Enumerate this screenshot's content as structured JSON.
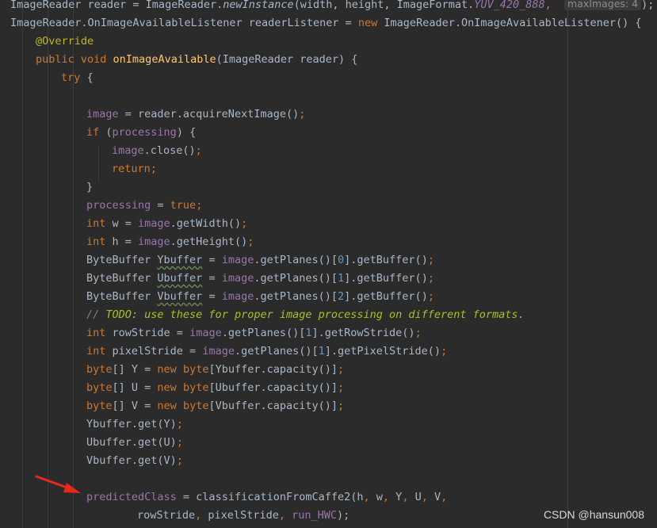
{
  "code": {
    "l0": [
      "ImageReader reader = ImageReader.",
      "newInstance",
      "(width, height, ImageFormat.",
      "YUV_420_888",
      ",",
      "maxImages:",
      "4",
      ");"
    ],
    "l1": [
      "ImageReader.OnImageAvailableListener readerListener = ",
      "new",
      " ImageReader.OnImageAvailableListener() {"
    ],
    "l2": [
      "@Override"
    ],
    "l3": [
      "public void",
      " ",
      "onImageAvailable",
      "(ImageReader reader) {"
    ],
    "l4": [
      "try",
      " {"
    ],
    "l6": [
      "image",
      " = reader.acquireNextImage()",
      ";"
    ],
    "l7": [
      "if",
      " (",
      "processing",
      ") {"
    ],
    "l8": [
      "image",
      ".close()",
      ";"
    ],
    "l9": [
      "return;"
    ],
    "l10": [
      "}"
    ],
    "l11": [
      "processing",
      " = ",
      "true",
      ";"
    ],
    "l12": [
      "int",
      " w = ",
      "image",
      ".getWidth()",
      ";"
    ],
    "l13": [
      "int",
      " h = ",
      "image",
      ".getHeight()",
      ";"
    ],
    "l14": [
      "ByteBuffer ",
      "Ybuffer",
      " = ",
      "image",
      ".getPlanes()[",
      "0",
      "].getBuffer()",
      ";"
    ],
    "l15": [
      "ByteBuffer ",
      "Ubuffer",
      " = ",
      "image",
      ".getPlanes()[",
      "1",
      "].getBuffer()",
      ";"
    ],
    "l16": [
      "ByteBuffer ",
      "Vbuffer",
      " = ",
      "image",
      ".getPlanes()[",
      "2",
      "].getBuffer()",
      ";"
    ],
    "l17": [
      "// ",
      "TODO: use these for proper image processing on different formats."
    ],
    "l18": [
      "int",
      " rowStride = ",
      "image",
      ".getPlanes()[",
      "1",
      "].getRowStride()",
      ";"
    ],
    "l19": [
      "int",
      " pixelStride = ",
      "image",
      ".getPlanes()[",
      "1",
      "].getPixelStride()",
      ";"
    ],
    "l20": [
      "byte",
      "[] Y = ",
      "new",
      " ",
      "byte",
      "[Ybuffer.capacity()]",
      ";"
    ],
    "l21": [
      "byte",
      "[] U = ",
      "new",
      " ",
      "byte",
      "[Ubuffer.capacity()]",
      ";"
    ],
    "l22": [
      "byte",
      "[] V = ",
      "new",
      " ",
      "byte",
      "[Vbuffer.capacity()]",
      ";"
    ],
    "l23": [
      "Ybuffer.get(Y)",
      ";"
    ],
    "l24": [
      "Ubuffer.get(U)",
      ";"
    ],
    "l25": [
      "Vbuffer.get(V)",
      ";"
    ],
    "l27": [
      "predictedClass",
      " = classificationFromCaffe2(h",
      ",",
      " w",
      ",",
      " Y",
      ",",
      " U",
      ",",
      " V",
      ","
    ],
    "l28": [
      "rowStride",
      ",",
      " pixelStride",
      ",",
      " ",
      "run_HWC",
      ");"
    ]
  },
  "annotation": {
    "arrow_color": "#e8281e",
    "icon": "arrow-icon"
  },
  "watermark": "CSDN @hansun008",
  "colors": {
    "background": "#2b2b2b",
    "text": "#a9b7c6",
    "keyword": "#cc7832",
    "field": "#9876aa",
    "method": "#ffc66d",
    "annotation": "#bbb529",
    "number": "#6897bb",
    "comment": "#808080",
    "todo": "#a8c023"
  }
}
